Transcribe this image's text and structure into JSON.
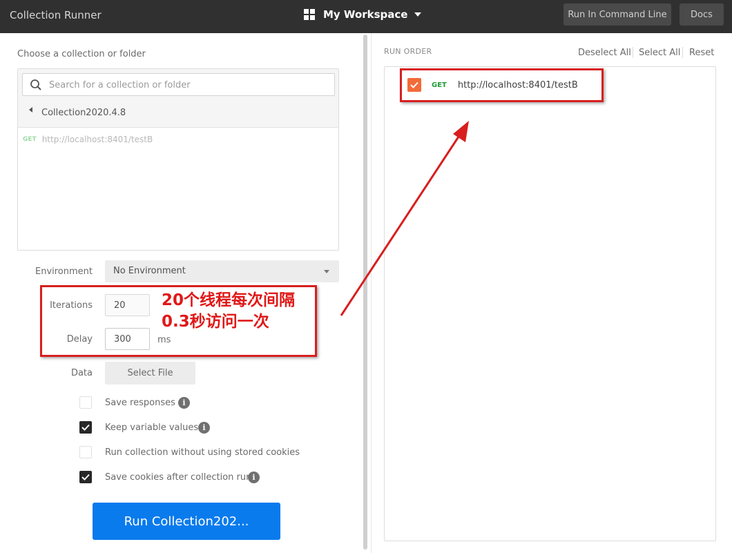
{
  "app": {
    "title": "Collection Runner"
  },
  "workspace": {
    "name": "My Workspace"
  },
  "toolbar": {
    "run_cli_label": "Run In Command Line",
    "docs_label": "Docs"
  },
  "left": {
    "choose_label": "Choose a collection or folder",
    "search_placeholder": "Search for a collection or folder",
    "collection_name": "Collection2020.4.8",
    "requests": [
      {
        "method": "GET",
        "url": "http://localhost:8401/testB"
      }
    ]
  },
  "form": {
    "environment_label": "Environment",
    "environment_value": "No Environment",
    "iterations_label": "Iterations",
    "iterations_value": "20",
    "delay_label": "Delay",
    "delay_value": "300",
    "delay_unit": "ms",
    "data_label": "Data",
    "select_file_label": "Select File"
  },
  "options": [
    {
      "label": "Save responses",
      "checked": false,
      "info": true
    },
    {
      "label": "Keep variable values",
      "checked": true,
      "info": true
    },
    {
      "label": "Run collection without using stored cookies",
      "checked": false,
      "info": false
    },
    {
      "label": "Save cookies after collection run",
      "checked": true,
      "info": true
    }
  ],
  "run_button_label": "Run Collection202...",
  "right": {
    "run_order_label": "RUN ORDER",
    "deselect_all": "Deselect All",
    "select_all": "Select All",
    "reset": "Reset",
    "items": [
      {
        "method": "GET",
        "url": "http://localhost:8401/testB",
        "checked": true
      }
    ]
  },
  "annotation": {
    "line1": "20个线程每次间隔",
    "line2": "0.3秒访问一次",
    "color": "#d81e1e"
  },
  "colors": {
    "accent": "#097bed",
    "checkbox_orange": "#f26b3a",
    "get_green": "#1e9b3a",
    "topbar": "#303030"
  },
  "icons": {
    "info": "i"
  }
}
